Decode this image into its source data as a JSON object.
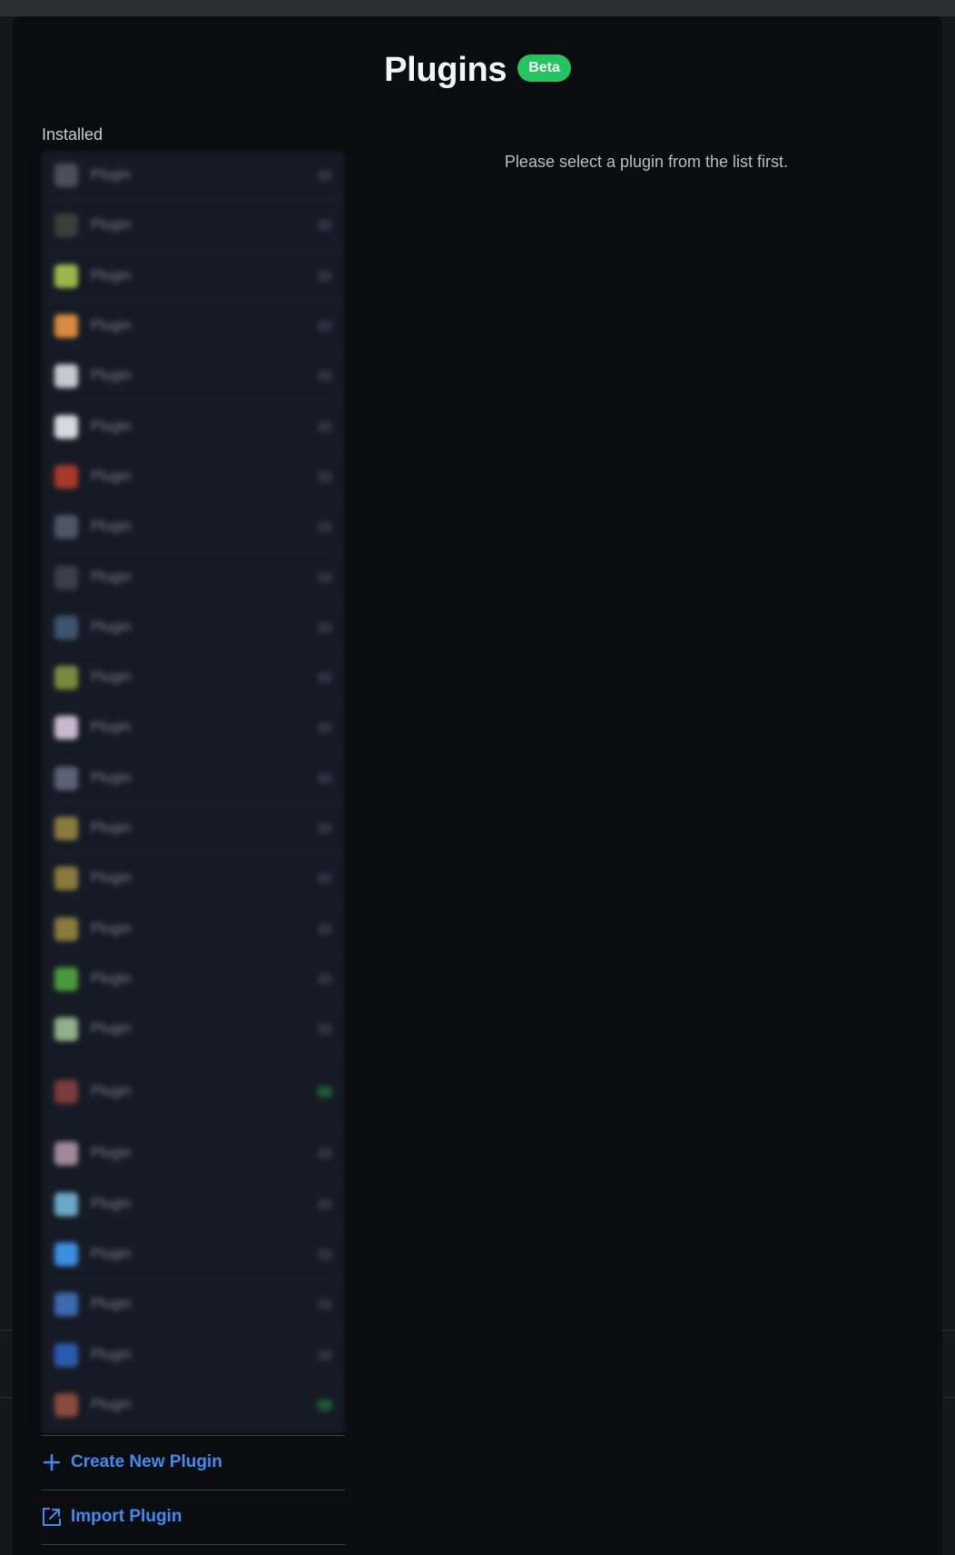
{
  "modal": {
    "title": "Plugins",
    "badge": "Beta"
  },
  "sidebar": {
    "section_label": "Installed",
    "plugins": [
      {
        "name": "Plugin",
        "icon_color": "#4a4f5c",
        "enabled": false
      },
      {
        "name": "Plugin",
        "icon_color": "#3a3f3a",
        "enabled": false
      },
      {
        "name": "Plugin",
        "icon_color": "#9ab84a",
        "enabled": false
      },
      {
        "name": "Plugin",
        "icon_color": "#d98a3c",
        "enabled": false
      },
      {
        "name": "Plugin",
        "icon_color": "#c7c9cf",
        "enabled": false
      },
      {
        "name": "Plugin",
        "icon_color": "#d7d9de",
        "enabled": false
      },
      {
        "name": "Plugin",
        "icon_color": "#a8382a",
        "enabled": false
      },
      {
        "name": "Plugin",
        "icon_color": "#4e5564",
        "enabled": false
      },
      {
        "name": "Plugin",
        "icon_color": "#3a3f49",
        "enabled": false
      },
      {
        "name": "Plugin",
        "icon_color": "#3d5470",
        "enabled": false
      },
      {
        "name": "Plugin",
        "icon_color": "#7a8a3c",
        "enabled": false
      },
      {
        "name": "Plugin",
        "icon_color": "#c9b7d0",
        "enabled": false
      },
      {
        "name": "Plugin",
        "icon_color": "#5b6275",
        "enabled": false
      },
      {
        "name": "Plugin",
        "icon_color": "#8a7a3c",
        "enabled": false
      },
      {
        "name": "Plugin",
        "icon_color": "#8a7a3c",
        "enabled": false
      },
      {
        "name": "Plugin",
        "icon_color": "#8a7a3c",
        "enabled": false
      },
      {
        "name": "Plugin",
        "icon_color": "#4a9a3c",
        "enabled": false
      },
      {
        "name": "Plugin",
        "icon_color": "#8fb08a",
        "enabled": false
      },
      {
        "name": "Plugin",
        "icon_color": "#7a3c3c",
        "enabled": true,
        "tall": true
      },
      {
        "name": "Plugin",
        "icon_color": "#a08a9a",
        "enabled": false
      },
      {
        "name": "Plugin",
        "icon_color": "#6aa8c8",
        "enabled": false
      },
      {
        "name": "Plugin",
        "icon_color": "#3a8fe0",
        "enabled": false
      },
      {
        "name": "Plugin",
        "icon_color": "#3a6ab0",
        "enabled": false
      },
      {
        "name": "Plugin",
        "icon_color": "#2a5ab0",
        "enabled": false
      },
      {
        "name": "Plugin",
        "icon_color": "#8a4a3c",
        "enabled": true
      }
    ],
    "actions": {
      "create_label": "Create New Plugin",
      "import_label": "Import Plugin"
    }
  },
  "detail": {
    "empty_message": "Please select a plugin from the list first."
  },
  "colors": {
    "accent": "#3b8cf5",
    "badge": "#22c55e"
  }
}
